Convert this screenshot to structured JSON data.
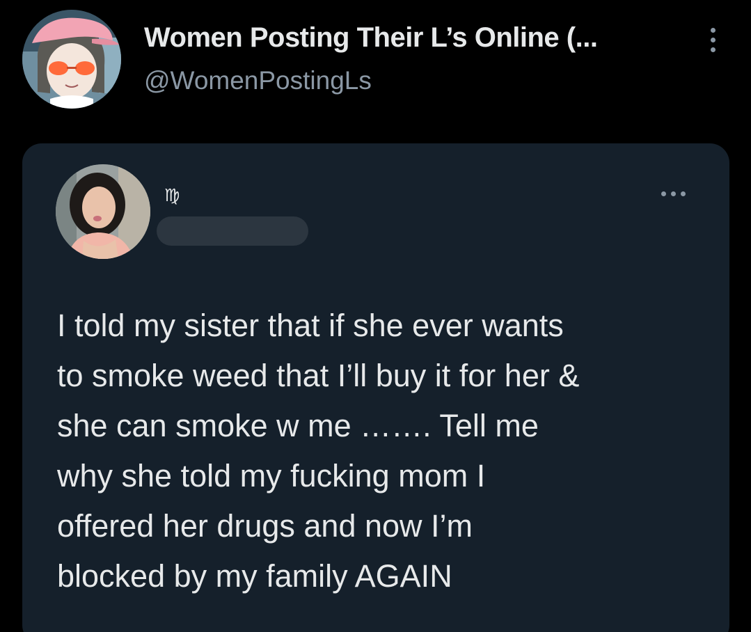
{
  "account": {
    "display_name": "Women Posting Their L’s Online (...",
    "handle": "@WomenPostingLs",
    "avatar_icon": "cartoon-girl-avatar",
    "menu_icon": "more-vertical-icon"
  },
  "quoted_tweet": {
    "avatar_icon": "woman-selfie-avatar",
    "name_glyph": "♍",
    "menu_icon": "more-horizontal-icon",
    "text_lines": [
      "I told my sister that if she ever wants",
      "to smoke weed that I’ll buy it for her &",
      "she can smoke w me ……. Tell me",
      "why she told my fucking mom I",
      "offered her drugs and now I’m",
      "blocked by my family AGAIN"
    ]
  },
  "colors": {
    "background": "#000000",
    "card_background": "#15202b",
    "primary_text": "#e7e9ea",
    "secondary_text": "#8b98a5",
    "redaction": "#2c3640"
  }
}
